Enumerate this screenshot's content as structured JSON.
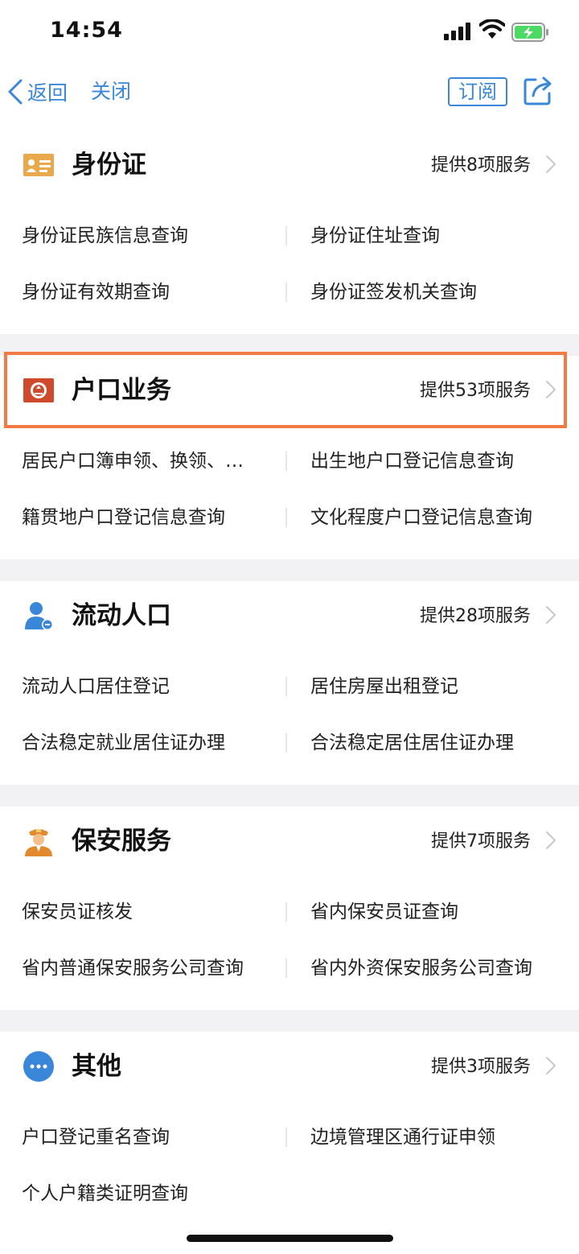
{
  "status": {
    "time": "14:54"
  },
  "nav": {
    "back_label": "返回",
    "close_label": "关闭",
    "subscribe_label": "订阅"
  },
  "colors": {
    "accent": "#3a87d9",
    "highlight": "#f47a44"
  },
  "sections": [
    {
      "title": "身份证",
      "count": "提供8项服务",
      "icon": "id-card-icon",
      "items": [
        "身份证民族信息查询",
        "身份证住址查询",
        "身份证有效期查询",
        "身份证签发机关查询"
      ]
    },
    {
      "title": "户口业务",
      "count": "提供53项服务",
      "icon": "police-badge-icon",
      "items": [
        "居民户口簿申领、换领、补领",
        "出生地户口登记信息查询",
        "籍贯地户口登记信息查询",
        "文化程度户口登记信息查询"
      ]
    },
    {
      "title": "流动人口",
      "count": "提供28项服务",
      "icon": "person-icon",
      "items": [
        "流动人口居住登记",
        "居住房屋出租登记",
        "合法稳定就业居住证办理",
        "合法稳定居住居住证办理"
      ]
    },
    {
      "title": "保安服务",
      "count": "提供7项服务",
      "icon": "security-guard-icon",
      "items": [
        "保安员证核发",
        "省内保安员证查询",
        "省内普通保安服务公司查询",
        "省内外资保安服务公司查询"
      ]
    },
    {
      "title": "其他",
      "count": "提供3项服务",
      "icon": "more-dots-icon",
      "items": [
        "户口登记重名查询",
        "边境管理区通行证申领",
        "个人户籍类证明查询"
      ]
    }
  ]
}
